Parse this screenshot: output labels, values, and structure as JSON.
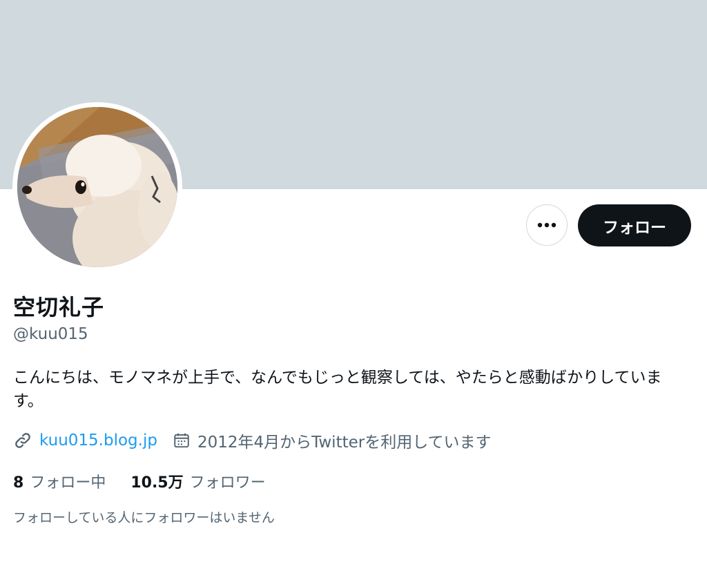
{
  "profile": {
    "name": "空切礼子",
    "handle": "@kuu015",
    "bio": "こんにちは、モノマネが上手で、なんでもじっと観察しては、やたらと感動ばかりしています。",
    "website": "kuu015.blog.jp",
    "joined": "2012年4月からTwitterを利用しています"
  },
  "actions": {
    "follow_label": "フォロー",
    "more_icon": "more-horizontal-icon"
  },
  "stats": {
    "following_count": "8",
    "following_label": "フォロー中",
    "followers_count": "10.5万",
    "followers_label": "フォロワー"
  },
  "followers_you_know": "フォローしている人にフォロワーはいません",
  "colors": {
    "banner": "#cfd9de",
    "link": "#1d9bf0",
    "secondary_text": "#536471",
    "primary_text": "#0f1419",
    "follow_button": "#0f1419"
  }
}
